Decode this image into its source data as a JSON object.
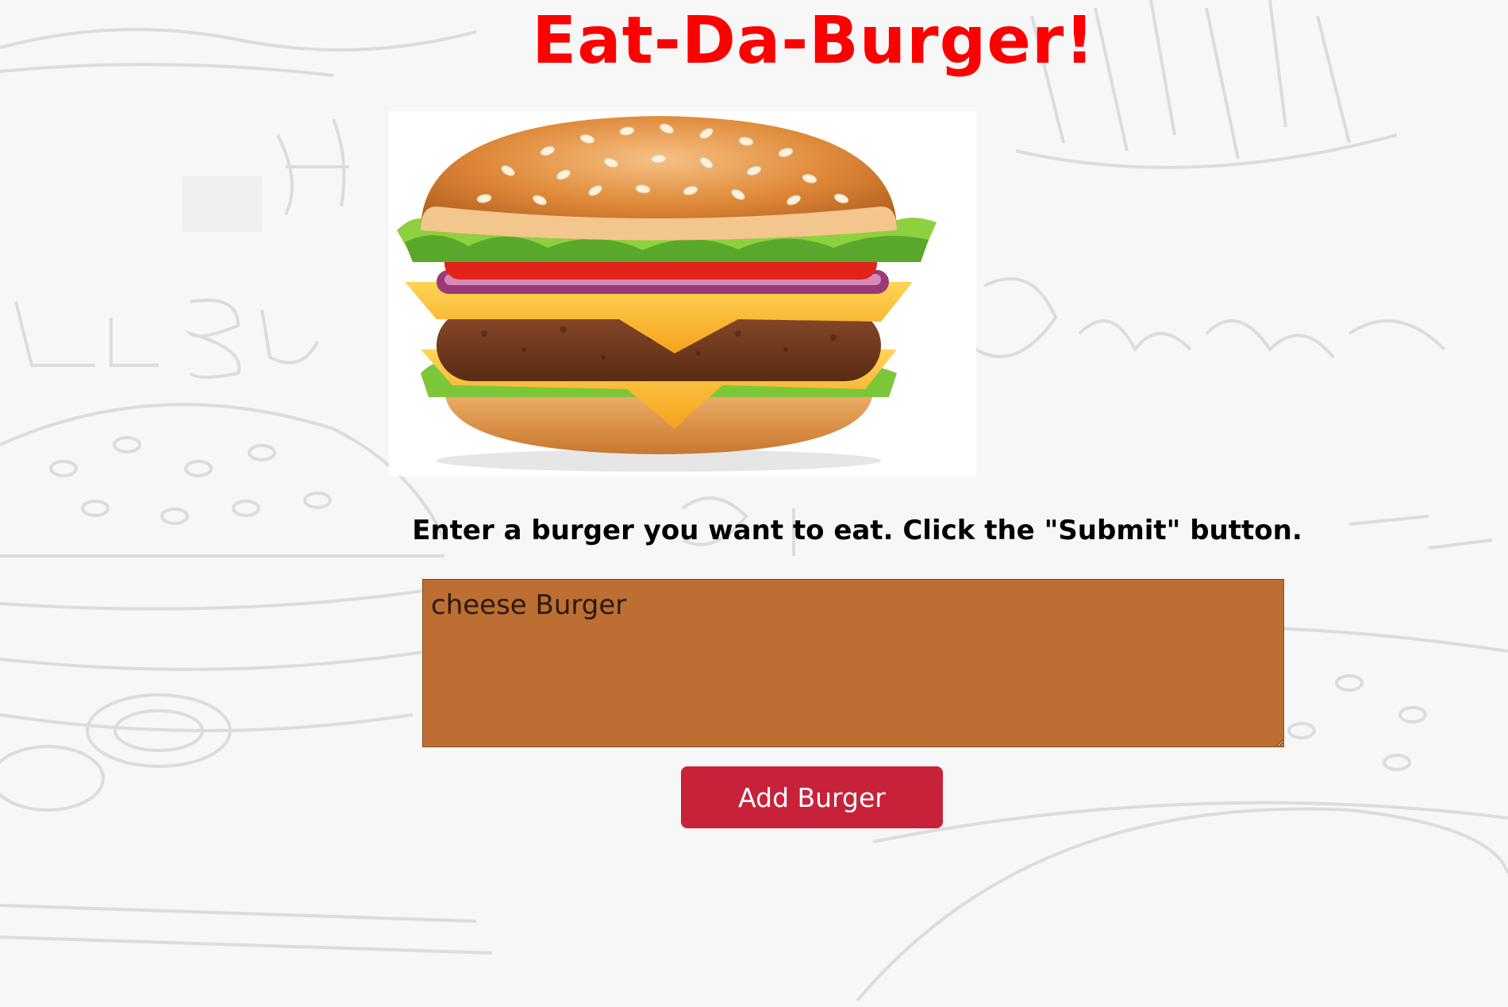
{
  "header": {
    "title": "Eat-Da-Burger!"
  },
  "hero": {
    "image_name": "hamburger-illustration"
  },
  "form": {
    "instructions": "Enter a burger you want to eat. Click the \"Submit\" button.",
    "textarea_value": "cheese Burger",
    "submit_label": "Add Burger"
  },
  "colors": {
    "title": "#ff0000",
    "textarea_bg": "#bd6e32",
    "button_bg": "#c8223a",
    "button_text": "#ffffff",
    "page_bg": "#f7f7f7"
  }
}
